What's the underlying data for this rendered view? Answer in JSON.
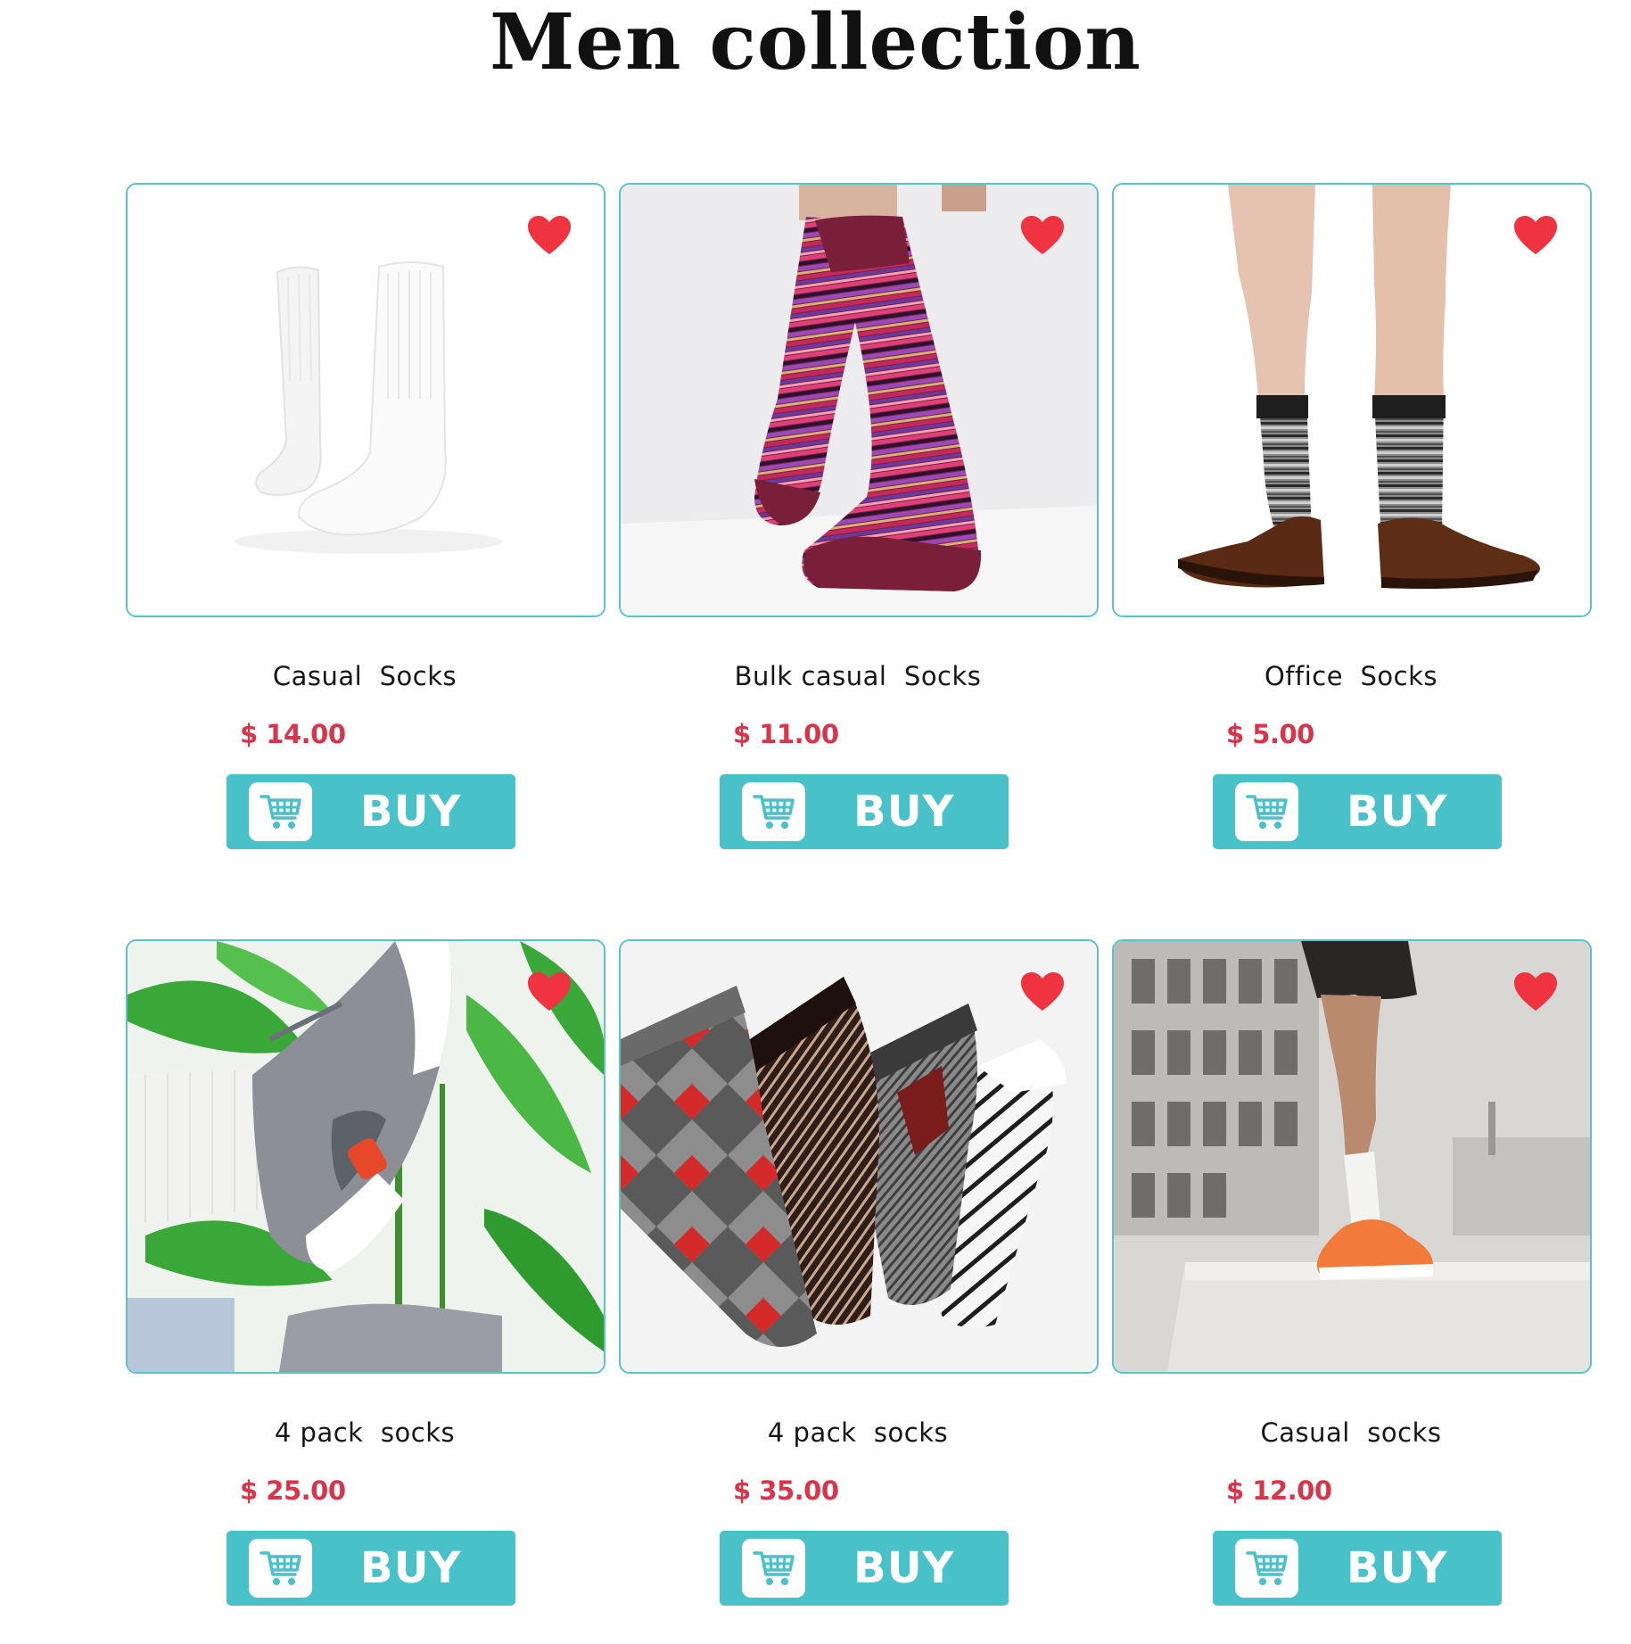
{
  "page": {
    "title": "Men collection"
  },
  "colors": {
    "accent_teal": "#49c1c9",
    "price_red": "#d9344a",
    "heart_red": "#ef3340",
    "card_border": "#58c4c9"
  },
  "products": [
    {
      "name": "Casual  Socks",
      "price": "$ 14.00",
      "buy_label": "BUY",
      "icons": [
        "heart-icon",
        "cart-icon"
      ]
    },
    {
      "name": "Bulk casual  Socks",
      "price": "$ 11.00",
      "buy_label": "BUY",
      "icons": [
        "heart-icon",
        "cart-icon"
      ]
    },
    {
      "name": "Office  Socks",
      "price": "$ 5.00",
      "buy_label": "BUY",
      "icons": [
        "heart-icon",
        "cart-icon"
      ]
    },
    {
      "name": "4 pack  socks",
      "price": "$ 25.00",
      "buy_label": "BUY",
      "icons": [
        "heart-icon",
        "cart-icon"
      ]
    },
    {
      "name": "4 pack  socks",
      "price": "$ 35.00",
      "buy_label": "BUY",
      "icons": [
        "heart-icon",
        "cart-icon"
      ]
    },
    {
      "name": "Casual  socks",
      "price": "$ 12.00",
      "buy_label": "BUY",
      "icons": [
        "heart-icon",
        "cart-icon"
      ]
    }
  ]
}
